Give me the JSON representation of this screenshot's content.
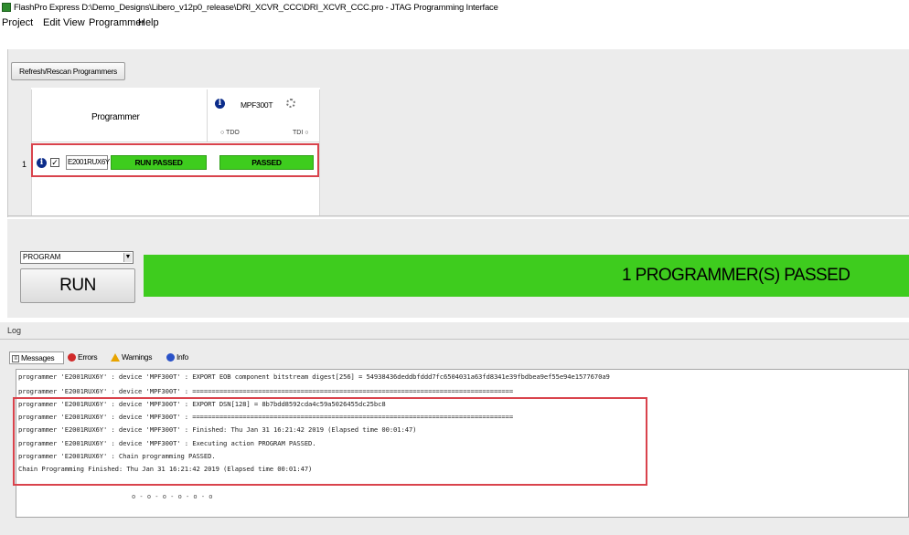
{
  "window": {
    "title": "FlashPro Express   D:\\Demo_Designs\\Libero_v12p0_release\\DRI_XCVR_CCC\\DRI_XCVR_CCC.pro  - JTAG Programming Interface"
  },
  "menu": [
    "Project",
    "Edit",
    "View",
    "Programmer",
    "Help"
  ],
  "toolbar": {
    "rescan_label": "Refresh/Rescan Programmers"
  },
  "grid": {
    "programmer_header": "Programmer",
    "device_name": "MPF300T",
    "tdo_label": "○ TDO",
    "tdi_label": "TDI ○",
    "row": {
      "index": "1",
      "checked": "✓",
      "serial": "E2001RUX6Y",
      "run_status": "RUN PASSED",
      "device_status": "PASSED"
    }
  },
  "action": {
    "selected": "PROGRAM",
    "run_label": "RUN",
    "status": "1 PROGRAMMER(S) PASSED"
  },
  "log": {
    "title": "Log",
    "tabs": {
      "messages": "Messages",
      "errors": "Errors",
      "warnings": "Warnings",
      "info": "Info"
    },
    "lines": [
      "programmer 'E2001RUX6Y' : device 'MPF300T' : EXPORT EOB component bitstream digest[256] = 54938436deddbfddd7fc6504031a63fd8341e39fbdbea9ef55e94e1577670a9",
      "programmer 'E2001RUX6Y' : device 'MPF300T' : ===================================================================================",
      "programmer 'E2001RUX6Y' : device 'MPF300T' : EXPORT DSN[128] = 8b7bdd8592cda4c59a5026455dc25bc8",
      "programmer 'E2001RUX6Y' : device 'MPF300T' : ===================================================================================",
      "programmer 'E2001RUX6Y' : device 'MPF300T' : Finished: Thu Jan 31 16:21:42 2019 (Elapsed time 00:01:47)",
      "programmer 'E2001RUX6Y' : device 'MPF300T' : Executing action PROGRAM PASSED.",
      "programmer 'E2001RUX6Y' : Chain programming PASSED.",
      "Chain Programming Finished: Thu Jan 31 16:21:42 2019 (Elapsed time 00:01:47)"
    ],
    "footer": "o - o - o - o - o - o"
  },
  "colors": {
    "pass_green": "#3ecc1e",
    "highlight_red": "#d9434c",
    "info_blue": "#0b2c8a"
  },
  "icons": [
    "app-icon",
    "info-icon",
    "chip-icon",
    "checkbox-icon",
    "dropdown-arrow-icon",
    "messages-icon",
    "error-icon",
    "warning-icon",
    "info-icon"
  ]
}
